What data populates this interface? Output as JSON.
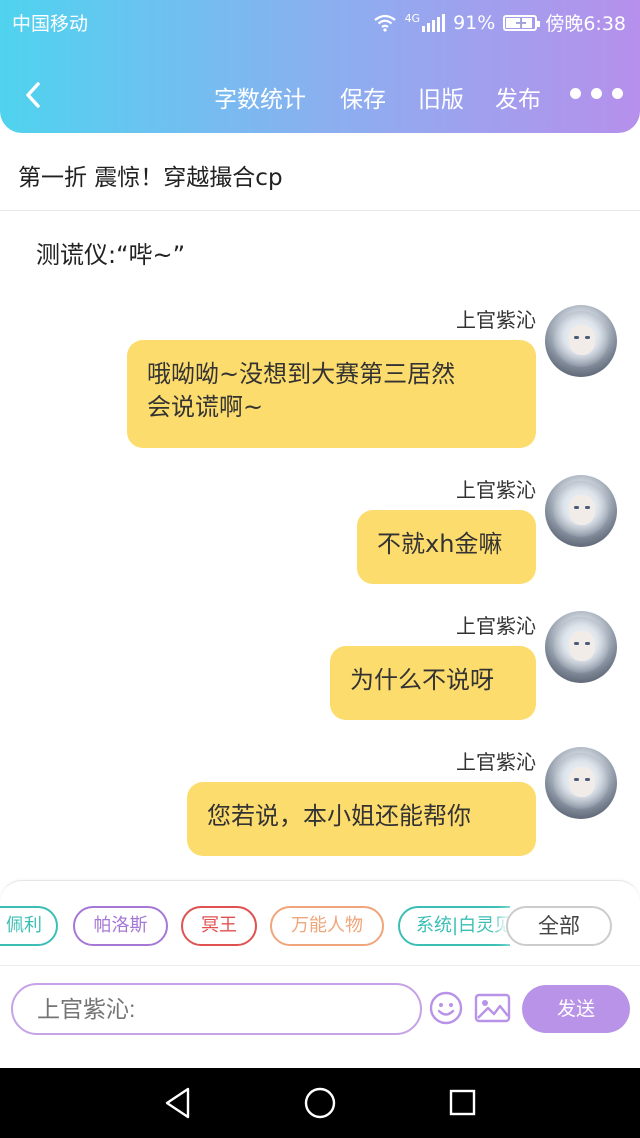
{
  "status_bar": {
    "carrier": "中国移动",
    "network": "4G",
    "battery": "91%",
    "time": "傍晚6:38"
  },
  "toolbar": {
    "word_count": "字数统计",
    "save": "保存",
    "old_version": "旧版",
    "publish": "发布"
  },
  "chapter": {
    "title": "第一折 震惊！穿越撮合cp"
  },
  "narration": "测谎仪:“哔~”",
  "messages": [
    {
      "sender": "上官紫沁",
      "text_lines": [
        "哦呦呦~没想到大赛第三居然",
        "会说谎啊~"
      ]
    },
    {
      "sender": "上官紫沁",
      "text": "不就xh金嘛"
    },
    {
      "sender": "上官紫沁",
      "text": "为什么不说呀"
    },
    {
      "sender": "上官紫沁",
      "text": "您若说，本小姐还能帮你"
    }
  ],
  "characters": [
    {
      "name": "佩利",
      "color": "#3bbfb5"
    },
    {
      "name": "帕洛斯",
      "color": "#a678d6"
    },
    {
      "name": "冥王",
      "color": "#e05252"
    },
    {
      "name": "万能人物",
      "color": "#f0a57a"
    },
    {
      "name": "系统|白灵见",
      "color": "#3bbfb5"
    }
  ],
  "all_characters": "全部",
  "composer": {
    "placeholder": "上官紫沁:",
    "send": "发送"
  },
  "colors": {
    "header_gradient_start": "#4fd3ef",
    "header_gradient_end": "#b690ec",
    "bubble": "#fddc6e",
    "accent": "#b993e8"
  }
}
